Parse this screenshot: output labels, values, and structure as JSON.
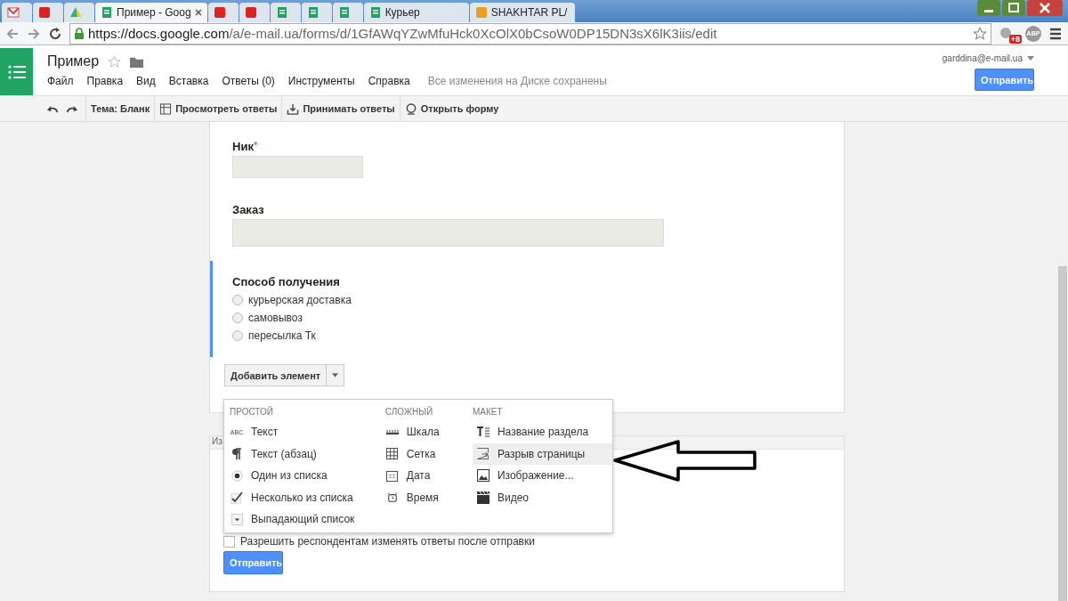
{
  "browser": {
    "tabs": [
      {
        "kind": "mail",
        "selected": false
      },
      {
        "kind": "red",
        "selected": false
      },
      {
        "kind": "drive",
        "selected": false
      },
      {
        "kind": "forms",
        "label": "Пример - Goog",
        "selected": true
      },
      {
        "kind": "red",
        "selected": false
      },
      {
        "kind": "red",
        "selected": false
      },
      {
        "kind": "forms",
        "selected": false
      },
      {
        "kind": "forms",
        "selected": false
      },
      {
        "kind": "forms",
        "selected": false
      },
      {
        "kind": "forms",
        "label": "Курьер",
        "selected": false
      },
      {
        "kind": "ball",
        "label": "SHAKHTAR PL/",
        "selected": false
      }
    ],
    "url_host": "https://docs.google.com",
    "url_path": "/a/e-mail.ua/forms/d/1GfAWqYZwMfuHck0XcOlX0bCsoW0DP15DN3sX6lK3iis/edit",
    "badge": "+8",
    "adblock": "ABP"
  },
  "app": {
    "title": "Пример",
    "menus": [
      "Файл",
      "Правка",
      "Вид",
      "Вставка",
      "Ответы (0)",
      "Инструменты",
      "Справка"
    ],
    "save_status": "Все изменения на Диске сохранены",
    "account": "garddina@e-mail.ua",
    "send": "Отправить"
  },
  "toolbar": {
    "theme": "Тема: Бланк",
    "items": [
      {
        "kind": "table",
        "label": "Просмотреть ответы"
      },
      {
        "kind": "download",
        "label": "Принимать ответы"
      },
      {
        "kind": "globe",
        "label": "Открыть форму"
      }
    ]
  },
  "form": {
    "questions": [
      {
        "kind": "text",
        "label": "Ник",
        "required_mark": "*",
        "active": false
      },
      {
        "kind": "paragraph",
        "label": "Заказ",
        "active": false
      },
      {
        "kind": "choice",
        "label": "Способ получения",
        "active": true,
        "options": [
          {
            "label": "курьерская доставка",
            "selected": false
          },
          {
            "label": "самовывоз",
            "selected": false
          },
          {
            "label": "пересылка Тк",
            "selected": false
          }
        ]
      }
    ],
    "add_button": "Добавить элемент"
  },
  "menu": {
    "columns": [
      {
        "heading": "ПРОСТОЙ",
        "items": [
          {
            "kind": "abc",
            "icon_text": "ABC",
            "label": "Текст",
            "selected": false
          },
          {
            "kind": "pilcrow",
            "label": "Текст (абзац)",
            "selected": false
          },
          {
            "kind": "radio",
            "label": "Один из списка",
            "selected": false
          },
          {
            "kind": "check",
            "label": "Несколько из списка",
            "selected": false
          },
          {
            "kind": "dropdown",
            "label": "Выпадающий список",
            "selected": false
          }
        ]
      },
      {
        "heading": "СЛОЖНЫЙ",
        "items": [
          {
            "kind": "scale",
            "label": "Шкала",
            "selected": false
          },
          {
            "kind": "grid",
            "label": "Сетка",
            "selected": false
          },
          {
            "kind": "calendar",
            "label": "Дата",
            "selected": false
          },
          {
            "kind": "clock",
            "label": "Время",
            "selected": false
          }
        ]
      },
      {
        "heading": "МАКЕТ",
        "items": [
          {
            "kind": "title",
            "label": "Название раздела",
            "selected": false
          },
          {
            "kind": "pagebreak",
            "label": "Разрыв страницы",
            "selected": true
          },
          {
            "kind": "image",
            "label": "Изображение...",
            "selected": false
          },
          {
            "kind": "video",
            "label": "Видео",
            "selected": false
          }
        ]
      }
    ]
  },
  "settings": {
    "header": "Из",
    "checkbox": {
      "label": "Разрешить респондентам изменять ответы после отправки",
      "checked": false
    },
    "submit": "Отправить"
  }
}
